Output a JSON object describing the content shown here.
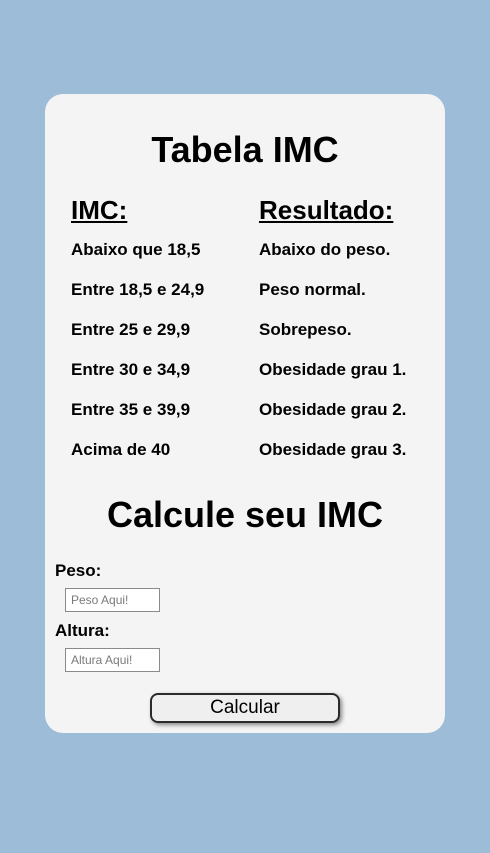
{
  "table": {
    "title": "Tabela IMC",
    "header_imc": "IMC:",
    "header_resultado": "Resultado:",
    "rows": [
      {
        "imc": "Abaixo que 18,5",
        "resultado": "Abaixo do peso."
      },
      {
        "imc": "Entre 18,5 e 24,9",
        "resultado": "Peso normal."
      },
      {
        "imc": "Entre 25 e 29,9",
        "resultado": "Sobrepeso."
      },
      {
        "imc": "Entre 30 e 34,9",
        "resultado": "Obesidade grau 1."
      },
      {
        "imc": "Entre 35 e 39,9",
        "resultado": "Obesidade grau 2."
      },
      {
        "imc": "Acima de 40",
        "resultado": "Obesidade grau 3."
      }
    ]
  },
  "calculator": {
    "title": "Calcule seu IMC",
    "peso_label": "Peso:",
    "peso_value": "",
    "peso_placeholder": "Peso Aqui!",
    "altura_label": "Altura:",
    "altura_value": "",
    "altura_placeholder": "Altura Aqui!",
    "button_label": "Calcular"
  },
  "colors": {
    "page_background": "#9dbcd8",
    "card_background": "#f4f4f4"
  }
}
